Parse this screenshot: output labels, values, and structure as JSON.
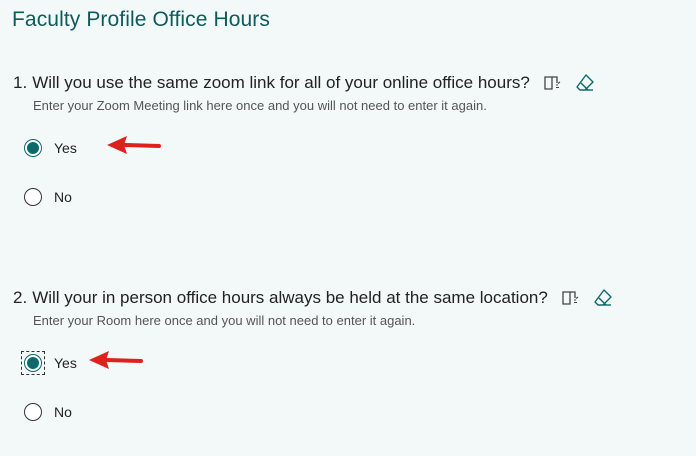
{
  "form": {
    "title": "Faculty Profile Office Hours"
  },
  "questions": [
    {
      "number": "1.",
      "text": "Will you use the same zoom link for all of your online office hours?",
      "subtitle": "Enter your Zoom Meeting link here once and you will not need to enter it again.",
      "options": [
        {
          "label": "Yes",
          "selected": true
        },
        {
          "label": "No",
          "selected": false
        }
      ]
    },
    {
      "number": "2.",
      "text": "Will your in person office hours always be held at the same location?",
      "subtitle": "Enter your Room here once and you will not need to enter it again.",
      "options": [
        {
          "label": "Yes",
          "selected": true
        },
        {
          "label": "No",
          "selected": false
        }
      ]
    }
  ],
  "icons": {
    "reader": "immersive-reader-icon",
    "eraser": "eraser-icon",
    "arrow": "red-arrow-icon"
  },
  "colors": {
    "accent": "#0d6a6a",
    "title": "#0f5b5b",
    "arrow": "#e0201c",
    "background": "#f3f8f9"
  }
}
